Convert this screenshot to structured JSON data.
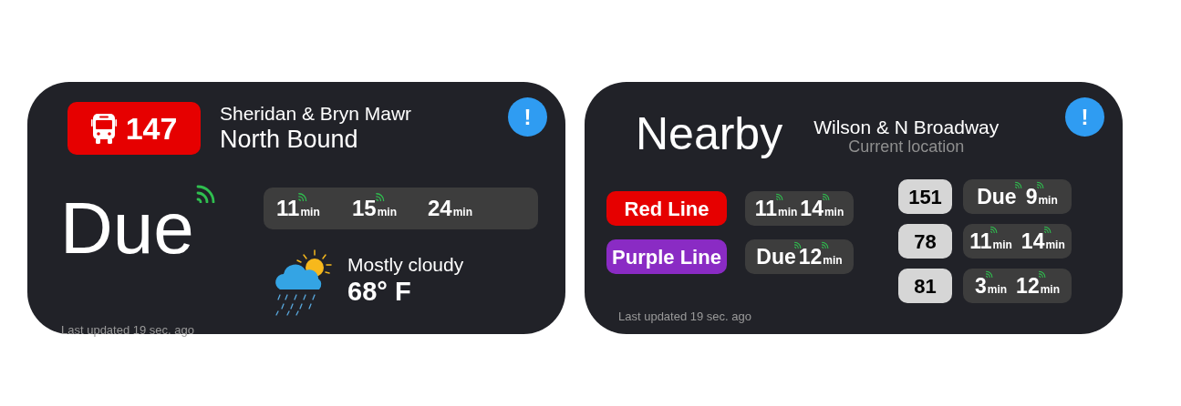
{
  "widgets": [
    {
      "kind": "route",
      "route": {
        "number": "147"
      },
      "stop": "Sheridan & Bryn Mawr",
      "direction": "North Bound",
      "alert": "!",
      "next": {
        "value": "Due",
        "live": true
      },
      "arrivals": [
        {
          "value": "11",
          "unit": "min",
          "live": true
        },
        {
          "value": "15",
          "unit": "min",
          "live": true
        },
        {
          "value": "24",
          "unit": "min",
          "live": false
        }
      ],
      "weather": {
        "condition": "Mostly cloudy",
        "temperature": "68° F"
      },
      "updated": "Last updated 19 sec. ago"
    },
    {
      "kind": "nearby",
      "title": "Nearby",
      "stop": "Wilson & N Broadway",
      "location": "Current location",
      "alert": "!",
      "trains": [
        {
          "name": "Red Line",
          "color": "#e60000",
          "arrivals": [
            {
              "value": "11",
              "unit": "min",
              "live": true
            },
            {
              "value": "14",
              "unit": "min",
              "live": true
            }
          ]
        },
        {
          "name": "Purple Line",
          "color": "#8a2bc4",
          "arrivals": [
            {
              "value": "Due",
              "live": true
            },
            {
              "value": "12",
              "unit": "min",
              "live": true
            }
          ]
        }
      ],
      "buses": [
        {
          "route": "151",
          "arrivals": [
            {
              "value": "Due",
              "live": true
            },
            {
              "value": "9",
              "unit": "min",
              "live": true
            }
          ]
        },
        {
          "route": "78",
          "arrivals": [
            {
              "value": "11",
              "unit": "min",
              "live": true
            },
            {
              "value": "14",
              "unit": "min",
              "live": true
            }
          ]
        },
        {
          "route": "81",
          "arrivals": [
            {
              "value": "3",
              "unit": "min",
              "live": true
            },
            {
              "value": "12",
              "unit": "min",
              "live": true
            }
          ]
        }
      ],
      "updated": "Last updated 19 sec. ago"
    }
  ]
}
